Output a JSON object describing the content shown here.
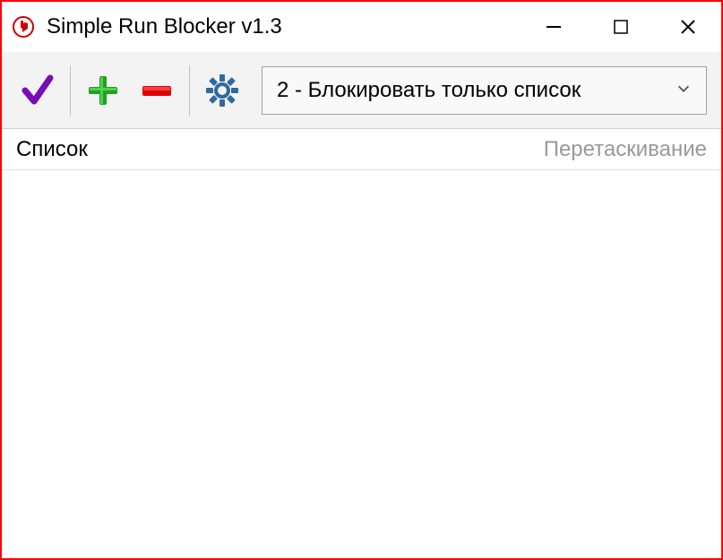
{
  "window": {
    "title": "Simple Run Blocker v1.3"
  },
  "toolbar": {
    "mode_selected": "2 - Блокировать только список"
  },
  "list": {
    "header": "Список",
    "drag_hint": "Перетаскивание"
  }
}
